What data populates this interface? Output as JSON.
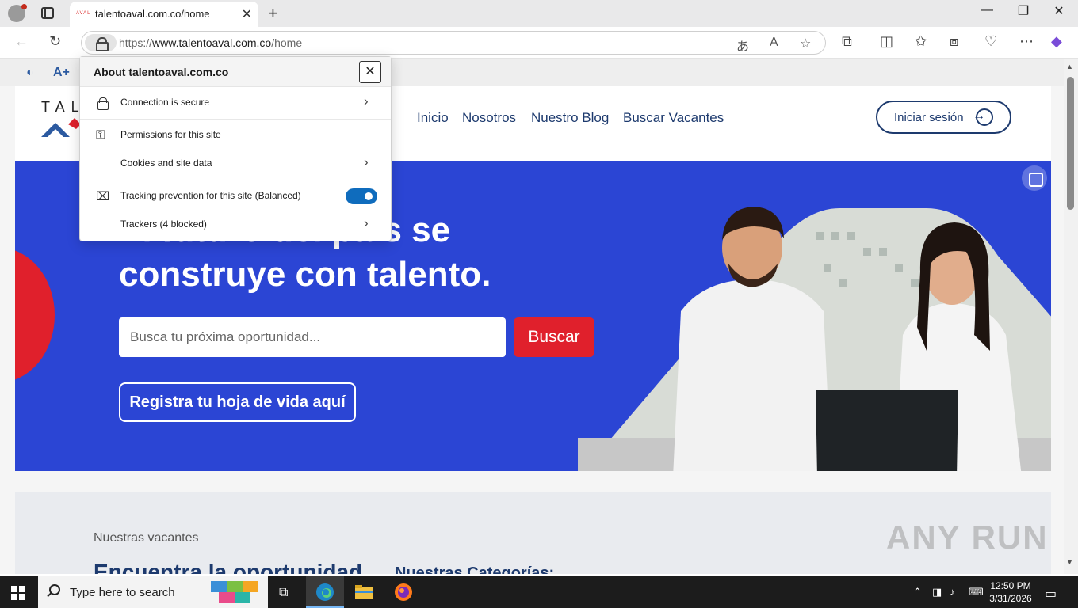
{
  "browser": {
    "tab_title": "talentoaval.com.co/home",
    "favicon_text": "AVAL",
    "url_prefix": "https://",
    "url_host": "www.talentoaval.com.co",
    "url_path": "/home",
    "window_controls": {
      "minimize": "—",
      "restore": "❐",
      "close": "✕"
    }
  },
  "site_info": {
    "title": "About talentoaval.com.co",
    "close": "✕",
    "connection": "Connection is secure",
    "permissions": "Permissions for this site",
    "cookies": "Cookies and site data",
    "tracking": "Tracking prevention for this site (Balanced)",
    "trackers": "Trackers (4 blocked)",
    "tracking_enabled": true
  },
  "site": {
    "logo_text": "TAL",
    "nav": [
      "Inicio",
      "Nosotros",
      "Nuestro Blog",
      "Buscar Vacantes"
    ],
    "login_label": "Iniciar sesión",
    "hero_line1": "El futuro del país se",
    "hero_line2": "construye con talento.",
    "search_placeholder": "Busca tu próxima oportunidad...",
    "search_button": "Buscar",
    "register_button": "Registra tu hoja de vida aquí",
    "vacancies_label": "Nuestras vacantes",
    "vacancies_title": "Encuentra la oportunidad",
    "categories_title": "Nuestras Categorías:"
  },
  "watermark": "ANY RUN",
  "taskbar": {
    "search_text": "Type here to search",
    "time": "12:50 PM",
    "date": "3/31/2026"
  },
  "colors": {
    "hero_blue": "#2b45d4",
    "brand_navy": "#1d3a6e",
    "accent_red": "#e0202c",
    "toggle_blue": "#0f6cbd"
  }
}
